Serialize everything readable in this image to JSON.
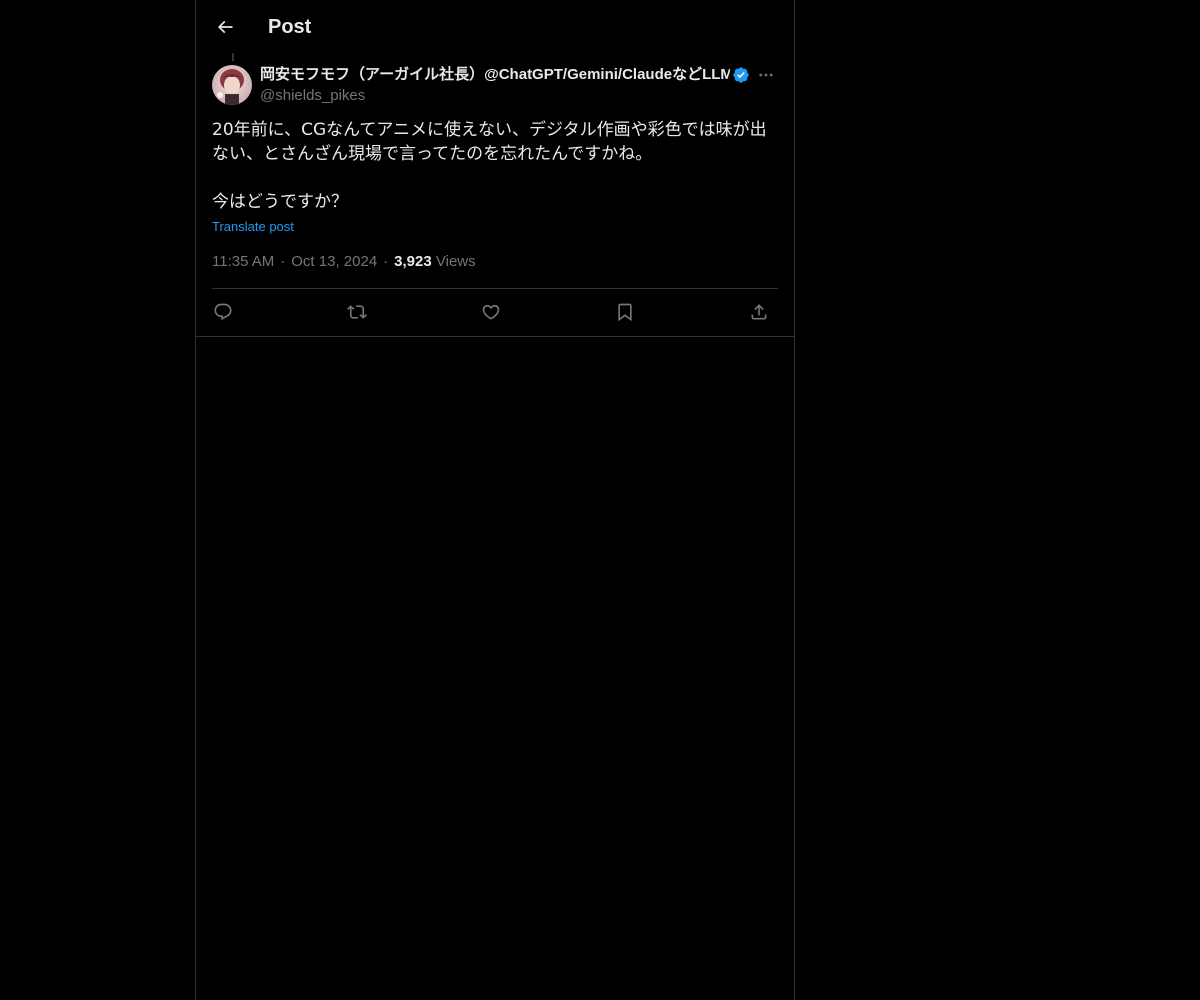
{
  "header": {
    "title": "Post",
    "back_icon": "arrow-left-icon"
  },
  "author": {
    "display_name": "岡安モフモフ（アーガイル社長）@ChatGPT/Gemini/ClaudeなどLLM",
    "handle": "@shields_pikes",
    "verified": true,
    "verified_color": "#1d9bf0"
  },
  "post": {
    "text": "20年前に、CGなんてアニメに使えない、デジタル作画や彩色では味が出ない、とさんざん現場で言ってたのを忘れたんですかね。\n\n今はどうですか？",
    "translate_label": "Translate post",
    "time": "11:35 AM",
    "date": "Oct 13, 2024",
    "views_count": "3,923",
    "views_label": "Views"
  },
  "actions": [
    {
      "name": "reply",
      "icon": "reply-icon"
    },
    {
      "name": "repost",
      "icon": "repost-icon"
    },
    {
      "name": "like",
      "icon": "heart-icon"
    },
    {
      "name": "bookmark",
      "icon": "bookmark-icon"
    },
    {
      "name": "share",
      "icon": "share-icon"
    }
  ],
  "colors": {
    "background": "#000000",
    "text": "#e7e9ea",
    "secondary_text": "#71767b",
    "link": "#1d9bf0",
    "border": "#2f3336"
  }
}
